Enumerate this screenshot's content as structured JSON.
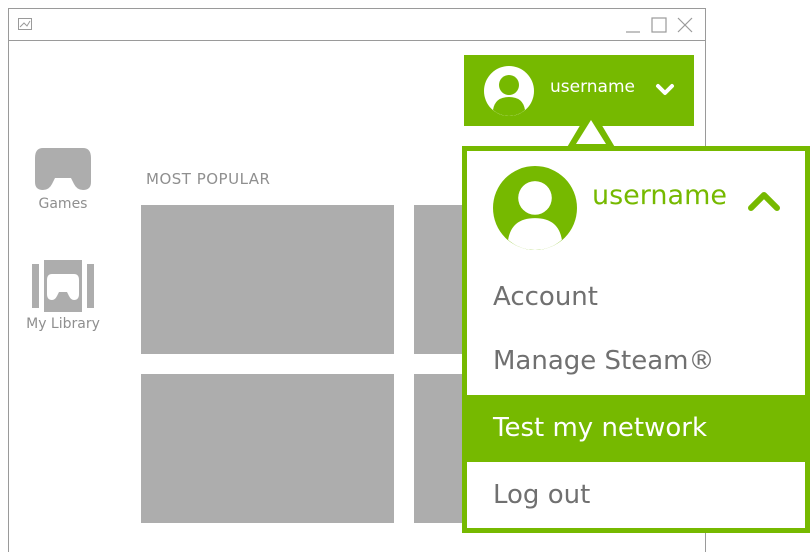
{
  "window": {
    "icon": "app-icon",
    "controls": [
      "minimize-icon",
      "maximize-icon",
      "close-icon"
    ]
  },
  "nav": {
    "games_label": "Games",
    "library_label": "My Library"
  },
  "main": {
    "section_title": "MOST POPULAR"
  },
  "user": {
    "name": "username"
  },
  "dropdown": {
    "items": [
      {
        "label": "Account"
      },
      {
        "label": "Manage Steam®"
      },
      {
        "label": "Test my network"
      },
      {
        "label": "Log out"
      }
    ]
  },
  "colors": {
    "accent": "#76b900",
    "tile": "#adadad",
    "muted_text": "#8f8f8f",
    "menu_text": "#707070",
    "frame": "#9a9a9a"
  }
}
